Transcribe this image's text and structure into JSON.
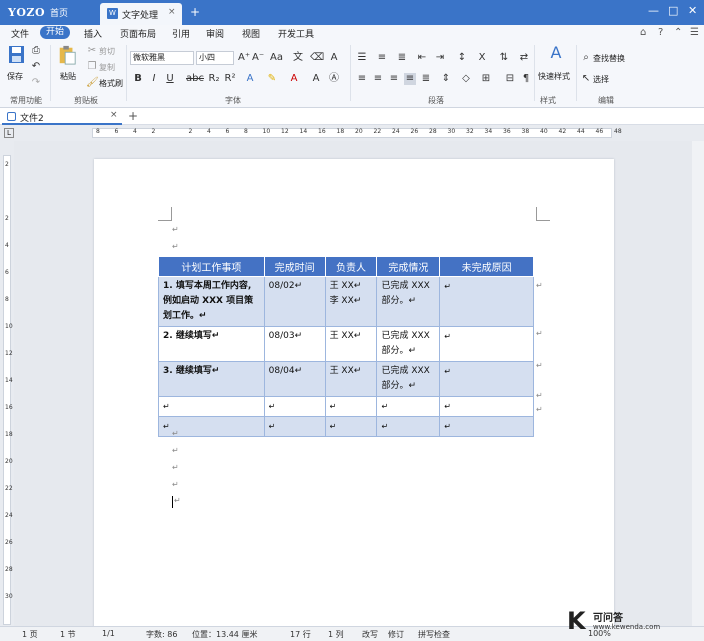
{
  "titlebar": {
    "logo": "YOZO",
    "home": "首页",
    "doc_tab": "文字处理",
    "doc_tab_icon": "W",
    "close": "×",
    "plus": "+",
    "min": "—",
    "max": "□",
    "close_win": "✕"
  },
  "menu": {
    "items": [
      "文件",
      "开始",
      "插入",
      "页面布局",
      "引用",
      "审阅",
      "视图",
      "开发工具"
    ],
    "active_index": 1
  },
  "ribbon": {
    "save_label": "保存",
    "paste_label": "粘贴",
    "cut_label": "剪切",
    "copy_label": "复制",
    "format_painter_label": "格式刷",
    "font_name": "微软雅黑",
    "font_size": "小四",
    "quick_style_label": "快速样式",
    "find_replace_label": "查找替换",
    "select_label": "选择",
    "groups": {
      "common": "常用功能",
      "clipboard": "剪贴板",
      "font": "字体",
      "paragraph": "段落",
      "style": "样式",
      "edit": "编辑"
    }
  },
  "docstrip": {
    "tab_label": "文件2",
    "close": "×",
    "plus": "+"
  },
  "ruler": {
    "corner": "L",
    "ticks": [
      "8",
      "6",
      "4",
      "2",
      "",
      "2",
      "4",
      "6",
      "8",
      "10",
      "12",
      "14",
      "16",
      "18",
      "20",
      "22",
      "24",
      "26",
      "28",
      "30",
      "32",
      "34",
      "36",
      "38",
      "40",
      "42",
      "44",
      "46",
      "48"
    ]
  },
  "vruler": {
    "ticks": [
      "2",
      "",
      "2",
      "4",
      "6",
      "8",
      "10",
      "12",
      "14",
      "16",
      "18",
      "20",
      "22",
      "24",
      "26",
      "28",
      "30"
    ]
  },
  "document": {
    "para_mark": "↵",
    "table": {
      "headers": [
        "计划工作事项",
        "完成时间",
        "负责人",
        "完成情况",
        "未完成原因"
      ],
      "rows": [
        [
          "1. 填写本周工作内容, 例如启动 XXX 项目策划工作。↵",
          "08/02↵",
          "王 XX↵ 李 XX↵",
          "已完成 XXX 部分。↵",
          "↵"
        ],
        [
          "2. 继续填写↵",
          "08/03↵",
          "王 XX↵",
          "已完成 XXX 部分。↵",
          "↵"
        ],
        [
          "3. 继续填写↵",
          "08/04↵",
          "王 XX↵",
          "已完成 XXX 部分。↵",
          "↵"
        ],
        [
          "↵",
          "↵",
          "↵",
          "↵",
          "↵"
        ],
        [
          "↵",
          "↵",
          "↵",
          "↵",
          "↵"
        ]
      ]
    }
  },
  "status": {
    "page": "1 页",
    "section": "1 节",
    "page_of": "1/1",
    "words": "字数: 86",
    "position": "位置：13.44 厘米",
    "line": "17 行",
    "column": "1 列",
    "overtype": "改写",
    "track": "修订",
    "spellcheck": "拼写检查",
    "zoom": "100%"
  },
  "watermark": {
    "logo": "K",
    "text": "可问答",
    "url": "www.kewenda.com"
  }
}
